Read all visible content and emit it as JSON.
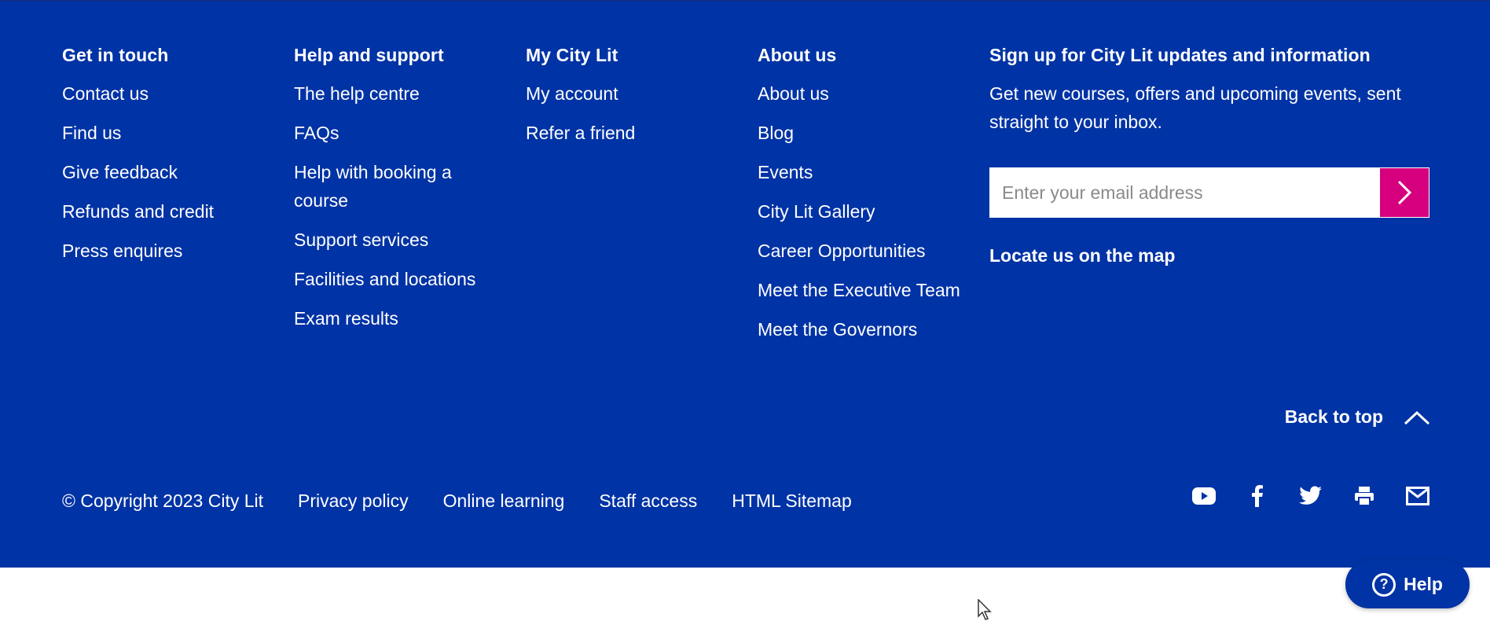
{
  "columns": [
    {
      "heading": "Get in touch",
      "links": [
        "Contact us",
        "Find us",
        "Give feedback",
        "Refunds and credit",
        "Press enquires"
      ]
    },
    {
      "heading": "Help and support",
      "links": [
        "The help centre",
        "FAQs",
        "Help with booking a course",
        "Support services",
        "Facilities and locations",
        "Exam results"
      ]
    },
    {
      "heading": "My City Lit",
      "links": [
        "My account",
        "Refer a friend"
      ]
    },
    {
      "heading": "About us",
      "links": [
        "About us",
        "Blog",
        "Events",
        "City Lit Gallery",
        "Career Opportunities",
        "Meet the Executive Team",
        "Meet the Governors"
      ]
    }
  ],
  "signup": {
    "heading": "Sign up for City Lit updates and information",
    "text": "Get new courses, offers and upcoming events, sent straight to your inbox.",
    "placeholder": "Enter your email address",
    "submit_icon": "chevron-right-icon",
    "locate_label": "Locate us on the map"
  },
  "back_to_top": "Back to top",
  "bottom_links": {
    "copyright": "© Copyright 2023 City Lit",
    "privacy": "Privacy policy",
    "online": "Online learning",
    "staff": "Staff access",
    "sitemap": "HTML Sitemap"
  },
  "social_icons": [
    "youtube-icon",
    "facebook-icon",
    "twitter-icon",
    "print-icon",
    "email-icon"
  ],
  "help_button": {
    "label": "Help",
    "icon": "question-icon"
  },
  "colors": {
    "footer_bg": "#0033a5",
    "submit_bg": "#d6007f",
    "text": "#ffffff"
  }
}
